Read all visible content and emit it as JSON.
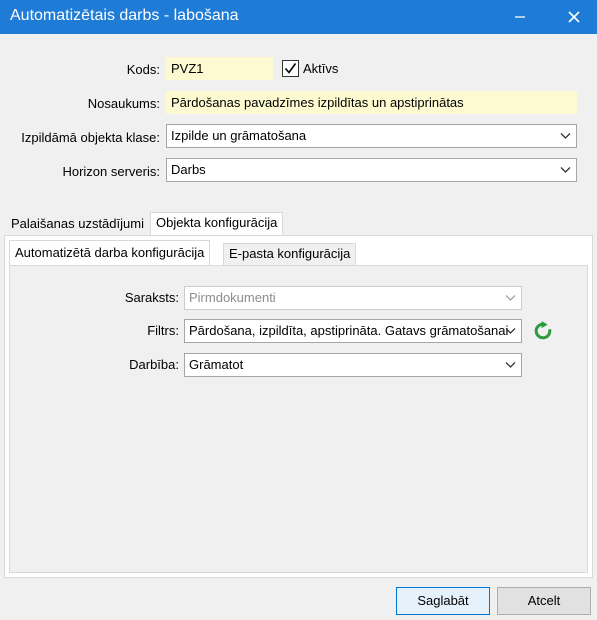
{
  "window": {
    "title": "Automatizētais darbs - labošana",
    "minimize_icon": "minimize-icon",
    "close_icon": "close-icon"
  },
  "form": {
    "code_label": "Kods:",
    "code_value": "PVZ1",
    "active_label": "Aktīvs",
    "active_checked": true,
    "name_label": "Nosaukums:",
    "name_value": "Pārdošanas pavadzīmes izpildītas un apstiprinātas",
    "class_label": "Izpildāmā objekta klase:",
    "class_value": "Izpilde un grāmatošana",
    "server_label": "Horizon serveris:",
    "server_value": "Darbs"
  },
  "tabs": [
    {
      "label": "Palaišanas uzstādījumi",
      "active": false
    },
    {
      "label": "Objekta konfigurācija",
      "active": true
    }
  ],
  "subtabs": [
    {
      "label": "Automatizētā darba konfigurācija",
      "active": true
    },
    {
      "label": "E-pasta konfigurācija",
      "active": false
    }
  ],
  "config": {
    "list_label": "Saraksts:",
    "list_value": "Pirmdokumenti",
    "list_disabled": true,
    "filter_label": "Filtrs:",
    "filter_value": "Pārdošana, izpildīta, apstiprināta. Gatavs grāmatošanai",
    "refresh_icon": "refresh-icon",
    "action_label": "Darbība:",
    "action_value": "Grāmatot"
  },
  "buttons": {
    "save_label": "Saglabāt",
    "cancel_label": "Atcelt"
  },
  "colors": {
    "titlebar": "#1e7bd6",
    "field_highlight": "#fdfad2",
    "refresh_icon": "#2e9a3a",
    "primary_button_border": "#0078d7"
  }
}
